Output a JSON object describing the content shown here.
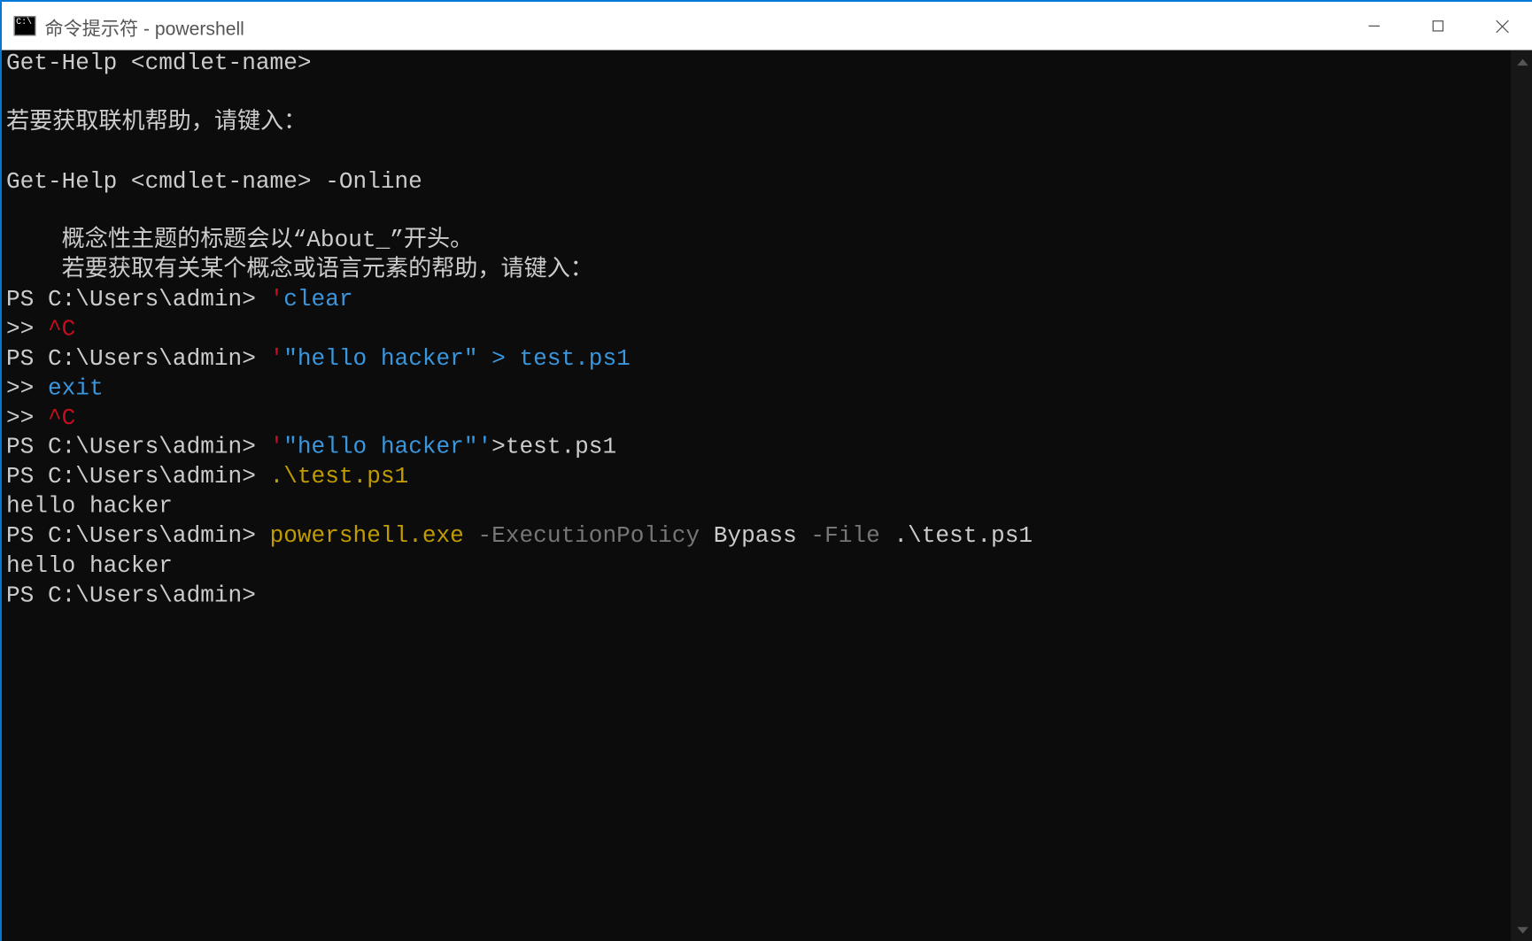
{
  "window": {
    "title": "命令提示符 - powershell"
  },
  "colors": {
    "bg": "#0c0c0c",
    "fg": "#cccccc",
    "red": "#c50f1f",
    "blue": "#3a96dd",
    "yellow": "#c19c00",
    "gray": "#767676"
  },
  "lines": [
    {
      "segments": [
        {
          "t": "Get-Help <cmdlet-name>",
          "c": "white"
        }
      ]
    },
    {
      "segments": [
        {
          "t": "",
          "c": "white"
        }
      ]
    },
    {
      "segments": [
        {
          "t": "若要获取联机帮助，请键入：",
          "c": "white"
        }
      ]
    },
    {
      "segments": [
        {
          "t": "",
          "c": "white"
        }
      ]
    },
    {
      "segments": [
        {
          "t": "Get-Help <cmdlet-name> -Online",
          "c": "white"
        }
      ]
    },
    {
      "segments": [
        {
          "t": "",
          "c": "white"
        }
      ]
    },
    {
      "segments": [
        {
          "t": "    概念性主题的标题会以“About_”开头。",
          "c": "white"
        }
      ]
    },
    {
      "segments": [
        {
          "t": "    若要获取有关某个概念或语言元素的帮助，请键入：",
          "c": "white"
        }
      ]
    },
    {
      "segments": [
        {
          "t": "PS C:\\Users\\admin> ",
          "c": "white"
        },
        {
          "t": "'",
          "c": "red"
        },
        {
          "t": "clear",
          "c": "blue"
        }
      ]
    },
    {
      "segments": [
        {
          "t": ">> ",
          "c": "white"
        },
        {
          "t": "^C",
          "c": "red"
        }
      ]
    },
    {
      "segments": [
        {
          "t": "PS C:\\Users\\admin> ",
          "c": "white"
        },
        {
          "t": "'",
          "c": "red"
        },
        {
          "t": "\"hello hacker\" > test.ps1",
          "c": "blue"
        }
      ]
    },
    {
      "segments": [
        {
          "t": ">> ",
          "c": "white"
        },
        {
          "t": "exit",
          "c": "blue"
        }
      ]
    },
    {
      "segments": [
        {
          "t": ">> ",
          "c": "white"
        },
        {
          "t": "^C",
          "c": "red"
        }
      ]
    },
    {
      "segments": [
        {
          "t": "PS C:\\Users\\admin> ",
          "c": "white"
        },
        {
          "t": "'",
          "c": "red"
        },
        {
          "t": "\"hello hacker\"'",
          "c": "blue"
        },
        {
          "t": ">",
          "c": "white"
        },
        {
          "t": "test.ps1",
          "c": "white"
        }
      ]
    },
    {
      "segments": [
        {
          "t": "PS C:\\Users\\admin> ",
          "c": "white"
        },
        {
          "t": ".\\test.ps1",
          "c": "yellow"
        }
      ]
    },
    {
      "segments": [
        {
          "t": "hello hacker",
          "c": "white"
        }
      ]
    },
    {
      "segments": [
        {
          "t": "PS C:\\Users\\admin> ",
          "c": "white"
        },
        {
          "t": "powershell.exe",
          "c": "yellow"
        },
        {
          "t": " ",
          "c": "white"
        },
        {
          "t": "-ExecutionPolicy",
          "c": "gray"
        },
        {
          "t": " Bypass ",
          "c": "white"
        },
        {
          "t": "-File",
          "c": "gray"
        },
        {
          "t": " .\\test.ps1",
          "c": "white"
        }
      ]
    },
    {
      "segments": [
        {
          "t": "hello hacker",
          "c": "white"
        }
      ]
    },
    {
      "segments": [
        {
          "t": "PS C:\\Users\\admin>",
          "c": "white"
        }
      ]
    }
  ]
}
